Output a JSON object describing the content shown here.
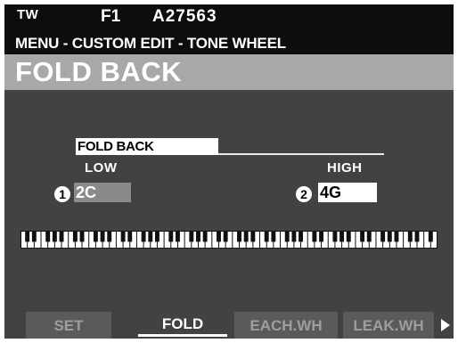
{
  "header": {
    "mode": "TW",
    "patch_number": "F1",
    "patch_name": "A27563",
    "breadcrumb": "MENU - CUSTOM EDIT - TONE WHEEL"
  },
  "page_title": "FOLD BACK",
  "foldback": {
    "section_label": "FOLD BACK",
    "low_label": "LOW",
    "high_label": "HIGH",
    "low_marker": "1",
    "high_marker": "2",
    "low_value": "2C",
    "high_value": "4G"
  },
  "tabs": {
    "set": "SET",
    "fold": "FOLD",
    "each_wh": "EACH.WH",
    "leak_wh": "LEAK.WH"
  },
  "colors": {
    "screen_bg": "#424242",
    "header_bg": "#0d0d0d",
    "title_bar_bg": "#a8a8a8",
    "low_field_bg": "#8a8a8a",
    "tab_bg": "#5a5a5a"
  },
  "icons": {
    "next_page": "arrow-right-icon",
    "keyboard": "keyboard-icon"
  }
}
